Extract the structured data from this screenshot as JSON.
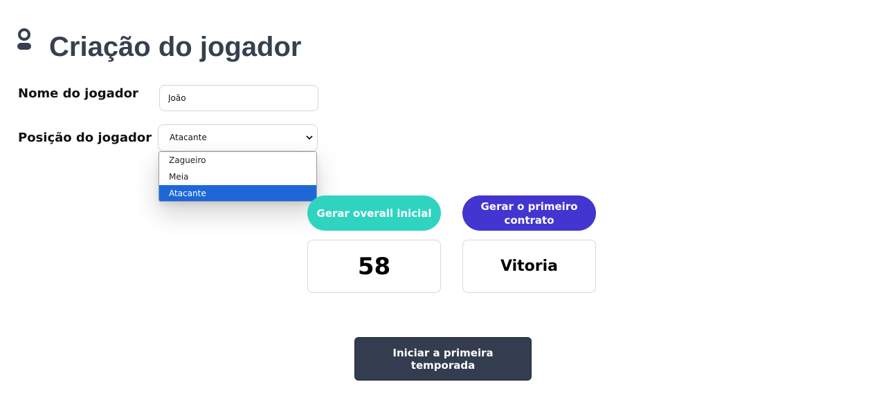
{
  "header": {
    "icon": "user-icon",
    "title": "Criação do jogador"
  },
  "form": {
    "name_label": "Nome do jogador",
    "name_value": "João",
    "position_label": "Posição do jogador",
    "position_selected": "Atacante",
    "position_options": [
      "Zagueiro",
      "Meia",
      "Atacante"
    ]
  },
  "actions": {
    "overall_button": "Gerar overall inicial",
    "contract_button": "Gerar o primeiro contrato",
    "season_button": "Iniciar a primeira temporada"
  },
  "results": {
    "overall": "58",
    "contract": "Vitoria"
  },
  "colors": {
    "title": "#36404f",
    "overall_button": "#2fd4c0",
    "contract_button": "#4335cf",
    "season_button": "#343d4f",
    "selected_option": "#1d67d8"
  }
}
